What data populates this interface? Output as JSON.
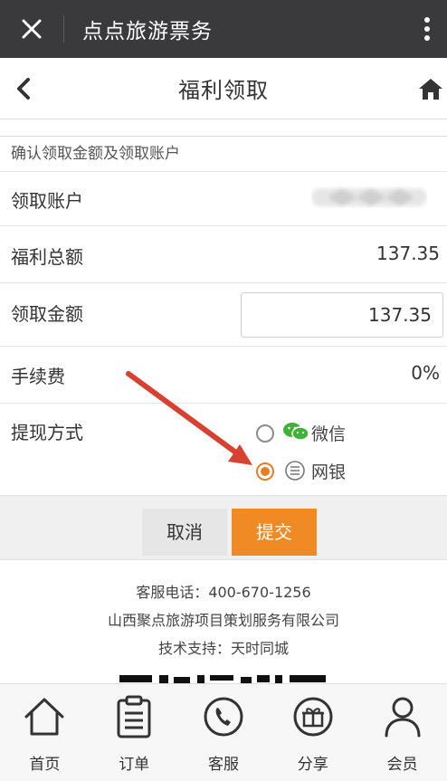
{
  "topbar": {
    "title": "点点旅游票务"
  },
  "navbar": {
    "title": "福利领取"
  },
  "section": {
    "header": "确认领取金额及领取账户"
  },
  "form": {
    "account": {
      "label": "领取账户"
    },
    "total": {
      "label": "福利总额",
      "value": "137.35"
    },
    "amount": {
      "label": "领取金额",
      "value": "137.35"
    },
    "fee": {
      "label": "手续费",
      "value": "0%"
    },
    "method": {
      "label": "提现方式",
      "options": [
        {
          "label": "微信",
          "icon": "wechat-icon",
          "checked": false
        },
        {
          "label": "网银",
          "icon": "bank-icon",
          "checked": true
        }
      ]
    }
  },
  "actions": {
    "cancel_label": "取消",
    "submit_label": "提交"
  },
  "footer": {
    "phone": "客服电话：400-670-1256",
    "company": "山西聚点旅游项目策划服务有限公司",
    "support": "技术支持：天时同城"
  },
  "tabs": [
    {
      "label": "首页",
      "icon": "home-icon"
    },
    {
      "label": "订单",
      "icon": "clipboard-icon"
    },
    {
      "label": "客服",
      "icon": "phone-icon"
    },
    {
      "label": "分享",
      "icon": "gift-icon"
    },
    {
      "label": "会员",
      "icon": "user-icon"
    }
  ],
  "colors": {
    "accent": "#f08a24",
    "radio_checked": "#e57e25",
    "wechat": "#3fb335",
    "arrow": "#d8402f"
  }
}
